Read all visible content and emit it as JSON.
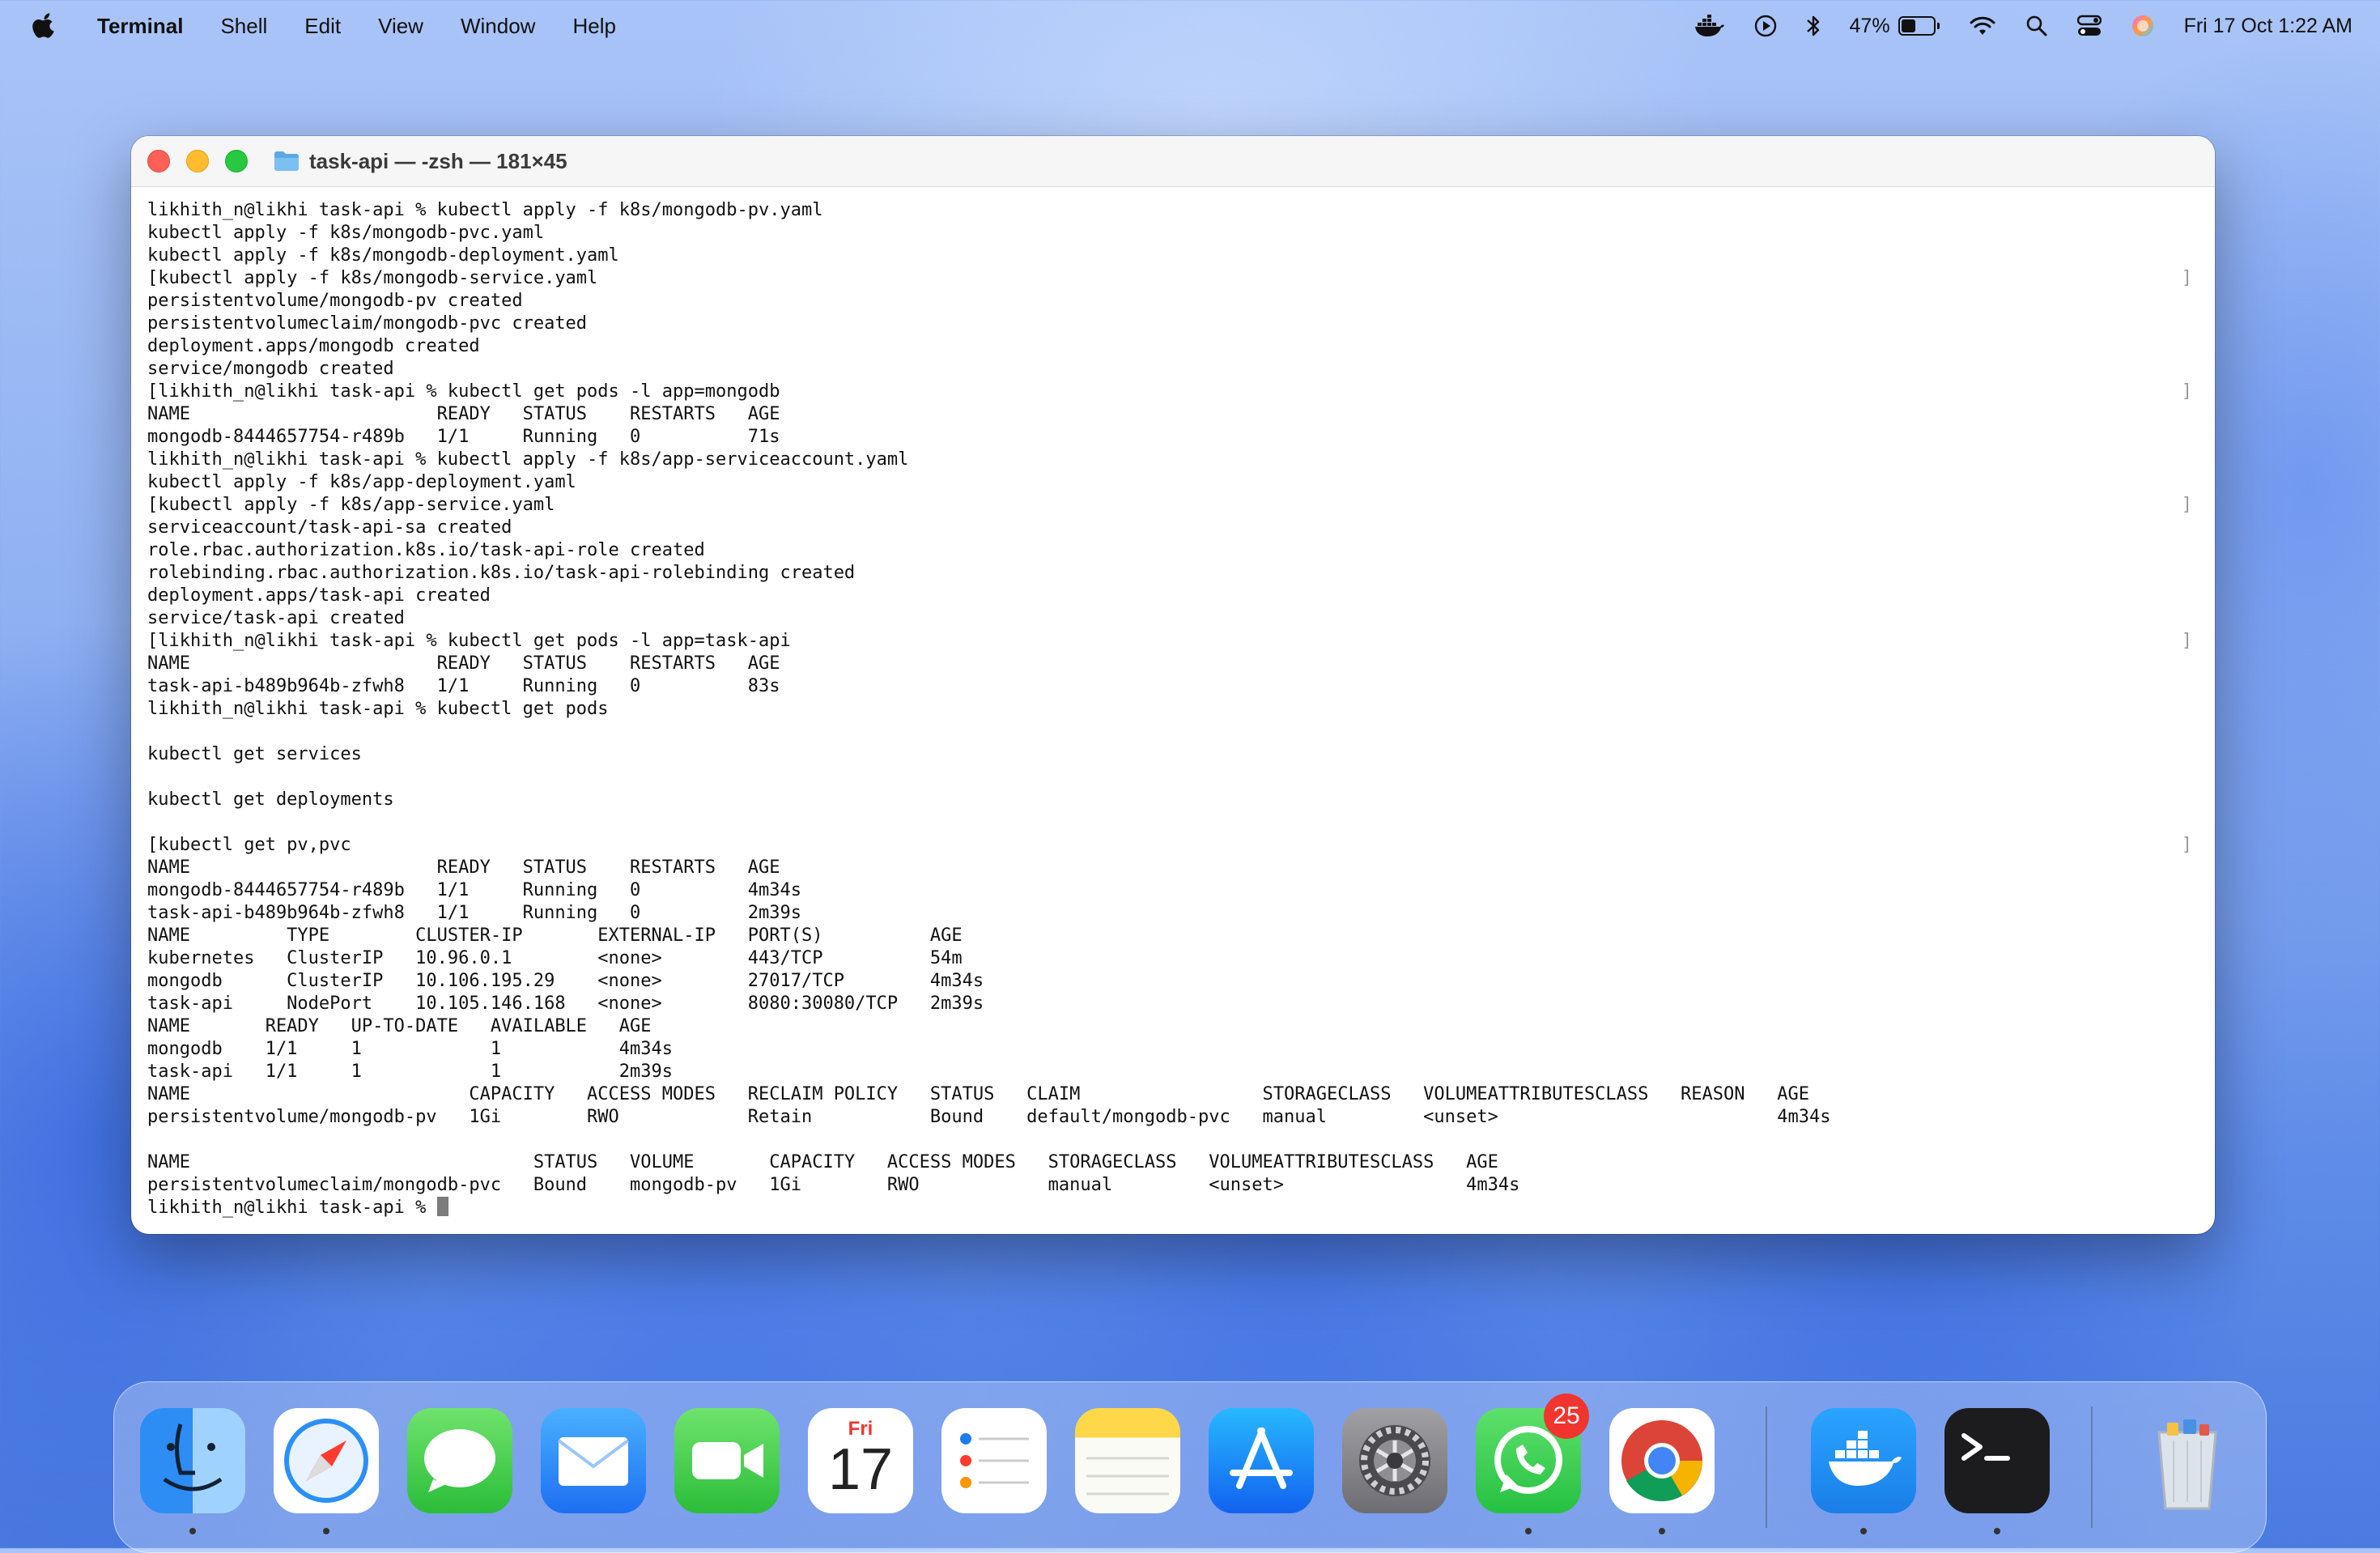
{
  "menubar": {
    "app_name": "Terminal",
    "items": [
      "Shell",
      "Edit",
      "View",
      "Window",
      "Help"
    ],
    "battery_percent": "47%",
    "battery_level": 0.47,
    "clock": "Fri 17 Oct  1:22 AM"
  },
  "window": {
    "title": "task-api — -zsh — 181×45"
  },
  "terminal": {
    "lines": [
      "likhith_n@likhi task-api % kubectl apply -f k8s/mongodb-pv.yaml",
      "kubectl apply -f k8s/mongodb-pvc.yaml",
      "kubectl apply -f k8s/mongodb-deployment.yaml",
      "[kubectl apply -f k8s/mongodb-service.yaml",
      "persistentvolume/mongodb-pv created",
      "persistentvolumeclaim/mongodb-pvc created",
      "deployment.apps/mongodb created",
      "service/mongodb created",
      "[likhith_n@likhi task-api % kubectl get pods -l app=mongodb",
      "NAME                       READY   STATUS    RESTARTS   AGE",
      "mongodb-8444657754-r489b   1/1     Running   0          71s",
      "likhith_n@likhi task-api % kubectl apply -f k8s/app-serviceaccount.yaml",
      "kubectl apply -f k8s/app-deployment.yaml",
      "[kubectl apply -f k8s/app-service.yaml",
      "serviceaccount/task-api-sa created",
      "role.rbac.authorization.k8s.io/task-api-role created",
      "rolebinding.rbac.authorization.k8s.io/task-api-rolebinding created",
      "deployment.apps/task-api created",
      "service/task-api created",
      "[likhith_n@likhi task-api % kubectl get pods -l app=task-api",
      "NAME                       READY   STATUS    RESTARTS   AGE",
      "task-api-b489b964b-zfwh8   1/1     Running   0          83s",
      "likhith_n@likhi task-api % kubectl get pods",
      "",
      "kubectl get services",
      "",
      "kubectl get deployments",
      "",
      "[kubectl get pv,pvc",
      "NAME                       READY   STATUS    RESTARTS   AGE",
      "mongodb-8444657754-r489b   1/1     Running   0          4m34s",
      "task-api-b489b964b-zfwh8   1/1     Running   0          2m39s",
      "NAME         TYPE        CLUSTER-IP       EXTERNAL-IP   PORT(S)          AGE",
      "kubernetes   ClusterIP   10.96.0.1        <none>        443/TCP          54m",
      "mongodb      ClusterIP   10.106.195.29    <none>        27017/TCP        4m34s",
      "task-api     NodePort    10.105.146.168   <none>        8080:30080/TCP   2m39s",
      "NAME       READY   UP-TO-DATE   AVAILABLE   AGE",
      "mongodb    1/1     1            1           4m34s",
      "task-api   1/1     1            1           2m39s",
      "NAME                          CAPACITY   ACCESS MODES   RECLAIM POLICY   STATUS   CLAIM                 STORAGECLASS   VOLUMEATTRIBUTESCLASS   REASON   AGE",
      "persistentvolume/mongodb-pv   1Gi        RWO            Retain           Bound    default/mongodb-pvc   manual         <unset>                          4m34s",
      "",
      "NAME                                STATUS   VOLUME       CAPACITY   ACCESS MODES   STORAGECLASS   VOLUMEATTRIBUTESCLASS   AGE",
      "persistentvolumeclaim/mongodb-pvc   Bound    mongodb-pv   1Gi        RWO            manual         <unset>                 4m34s",
      "likhith_n@likhi task-api % "
    ],
    "right_brackets": [
      3,
      8,
      13,
      19,
      28
    ]
  },
  "dock": {
    "items": [
      {
        "name": "finder",
        "running": true
      },
      {
        "name": "safari",
        "running": true
      },
      {
        "name": "messages",
        "running": false
      },
      {
        "name": "mail",
        "running": false
      },
      {
        "name": "facetime",
        "running": false
      },
      {
        "name": "calendar",
        "running": false,
        "month": "Fri",
        "day": "17"
      },
      {
        "name": "reminders",
        "running": false
      },
      {
        "name": "notes",
        "running": false
      },
      {
        "name": "app-store",
        "running": false
      },
      {
        "name": "system-settings",
        "running": false
      },
      {
        "name": "whatsapp",
        "running": true,
        "badge": "25"
      },
      {
        "name": "chrome",
        "running": true
      },
      {
        "name": "docker",
        "running": true
      },
      {
        "name": "terminal",
        "running": true
      },
      {
        "name": "trash",
        "running": false
      }
    ]
  }
}
